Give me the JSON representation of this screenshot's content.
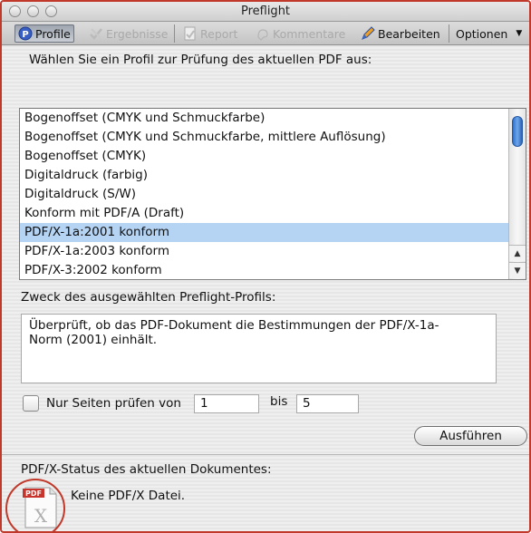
{
  "window": {
    "title": "Preflight"
  },
  "toolbar": {
    "items": [
      {
        "label": "Profile",
        "icon": "profile-p-icon",
        "enabled": true,
        "pressed": true
      },
      {
        "label": "Ergebnisse",
        "icon": "results-icon",
        "enabled": false
      },
      {
        "label": "Report",
        "icon": "report-icon",
        "enabled": false
      },
      {
        "label": "Kommentare",
        "icon": "comments-icon",
        "enabled": false
      },
      {
        "label": "Bearbeiten",
        "icon": "edit-pencil-icon",
        "enabled": true
      },
      {
        "label": "Optionen",
        "icon": "chevron-down-icon",
        "enabled": true
      }
    ]
  },
  "profiles": {
    "prompt": "Wählen Sie ein Profil zur Prüfung des aktuellen PDF aus:",
    "items": [
      "Bogenoffset (CMYK und Schmuckfarbe)",
      "Bogenoffset (CMYK und Schmuckfarbe, mittlere Auflösung)",
      "Bogenoffset (CMYK)",
      "Digitaldruck (farbig)",
      "Digitaldruck (S/W)",
      "Konform mit PDF/A (Draft)",
      "PDF/X-1a:2001 konform",
      "PDF/X-1a:2003 konform",
      "PDF/X-3:2002 konform"
    ],
    "selected_index": 6
  },
  "purpose": {
    "label": "Zweck des ausgewählten Preflight-Profils:",
    "text": "Überprüft, ob das PDF-Dokument die Bestimmungen der PDF/X-1a-\nNorm (2001) einhält."
  },
  "page_range": {
    "checkbox_label": "Nur Seiten prüfen von",
    "checked": false,
    "from": "1",
    "to_label": "bis",
    "to": "5"
  },
  "run_button": {
    "label": "Ausführen"
  },
  "status": {
    "label": "PDF/X-Status des aktuellen Dokumentes:",
    "value": "Keine PDF/X Datei.",
    "icon": "pdf-file-icon",
    "icon_badge": "PDF",
    "icon_mark": "X"
  },
  "colors": {
    "selection": "#b5d3f3",
    "highlight_circle": "#c0392b",
    "accent": "#2d6fc9"
  }
}
